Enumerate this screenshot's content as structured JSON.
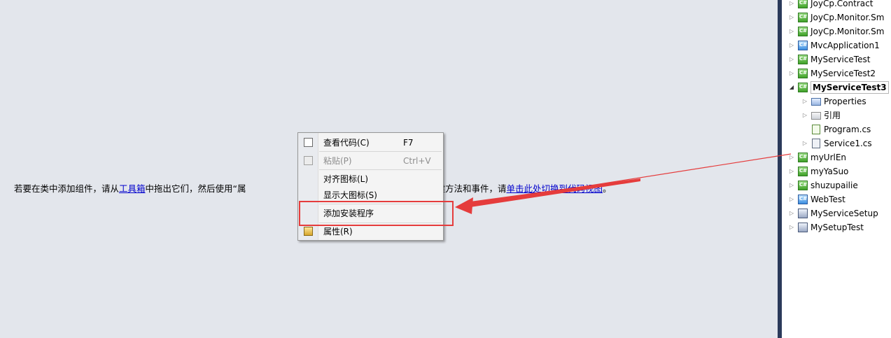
{
  "designer": {
    "hint_parts": [
      "若要在类中添加组件，请从",
      "工具箱",
      "中拖出它们，然后使用“属",
      "要为类创建方法和事件，请",
      "单击此处切换到代码视图",
      "。"
    ]
  },
  "context_menu": {
    "items": [
      {
        "label": "查看代码(C)",
        "shortcut": "F7",
        "icon": "view-code-icon"
      },
      {
        "label": "粘贴(P)",
        "shortcut": "Ctrl+V",
        "icon": "paste-icon",
        "disabled": true
      },
      {
        "label": "对齐图标(L)"
      },
      {
        "label": "显示大图标(S)"
      },
      {
        "label": "添加安装程序"
      },
      {
        "label": "属性(R)",
        "icon": "properties-icon"
      }
    ]
  },
  "solution_explorer": {
    "items": [
      {
        "label": "JoyCp.Contract",
        "icon": "csharp-project-icon"
      },
      {
        "label": "JoyCp.Monitor.Sm",
        "icon": "csharp-project-icon"
      },
      {
        "label": "JoyCp.Monitor.Sm",
        "icon": "csharp-project-icon"
      },
      {
        "label": "MvcApplication1",
        "icon": "web-project-icon"
      },
      {
        "label": "MyServiceTest",
        "icon": "csharp-project-icon"
      },
      {
        "label": "MyServiceTest2",
        "icon": "csharp-project-icon"
      },
      {
        "label": "MyServiceTest3",
        "icon": "csharp-project-icon",
        "expanded": true,
        "selected": true
      },
      {
        "label": "Properties",
        "icon": "properties-folder-icon"
      },
      {
        "label": "引用",
        "icon": "references-folder-icon"
      },
      {
        "label": "Program.cs",
        "icon": "cs-file-icon"
      },
      {
        "label": "Service1.cs",
        "icon": "service-file-icon"
      },
      {
        "label": "myUrlEn",
        "icon": "csharp-project-icon"
      },
      {
        "label": "myYaSuo",
        "icon": "csharp-project-icon"
      },
      {
        "label": "shuzupailie",
        "icon": "csharp-project-icon"
      },
      {
        "label": "WebTest",
        "icon": "web-project-icon"
      },
      {
        "label": "MyServiceSetup",
        "icon": "setup-project-icon"
      },
      {
        "label": "MySetupTest",
        "icon": "setup-project-icon"
      }
    ]
  },
  "annotation": {
    "color": "#e53c3c"
  }
}
